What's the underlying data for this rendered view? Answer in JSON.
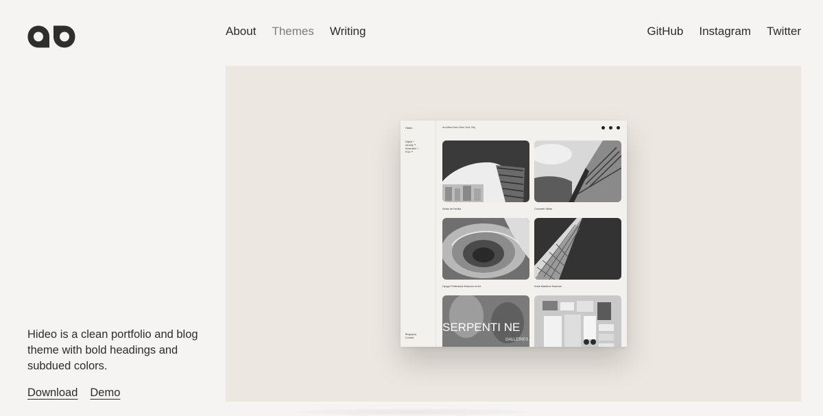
{
  "brand": {
    "logo": "logo-mark",
    "accent": "#2e2e2e"
  },
  "nav": {
    "main": [
      {
        "label": "About",
        "active": false
      },
      {
        "label": "Themes",
        "active": true
      },
      {
        "label": "Writing",
        "active": false
      }
    ],
    "social": [
      {
        "label": "GitHub"
      },
      {
        "label": "Instagram"
      },
      {
        "label": "Twitter"
      }
    ]
  },
  "intro": {
    "description": "Hideo is a clean portfolio and blog theme with bold headings and subdued colors.",
    "download_label": "Download",
    "demo_label": "Demo"
  },
  "preview": {
    "site_name": "Hideo",
    "tagline": "Architect from New York City",
    "categories": [
      "Digital ⁹",
      "Identity ¹⁶",
      "Illustration ⁴",
      "Print ¹⁸"
    ],
    "footer_links": [
      "Biography",
      "Contact"
    ],
    "social_icons": [
      "twitter-icon",
      "instagram-icon",
      "facebook-icon"
    ],
    "projects": [
      {
        "caption": "Setas de Sevilla"
      },
      {
        "caption": "Concrete Stairs"
      },
      {
        "caption": "Hyogo Prefectural Museum of Art"
      },
      {
        "caption": "Kobe Maritime Museum"
      },
      {
        "caption": ""
      },
      {
        "caption": ""
      }
    ],
    "poster_text": "SERPENTI NE",
    "poster_subtext": "GALLERIES"
  }
}
